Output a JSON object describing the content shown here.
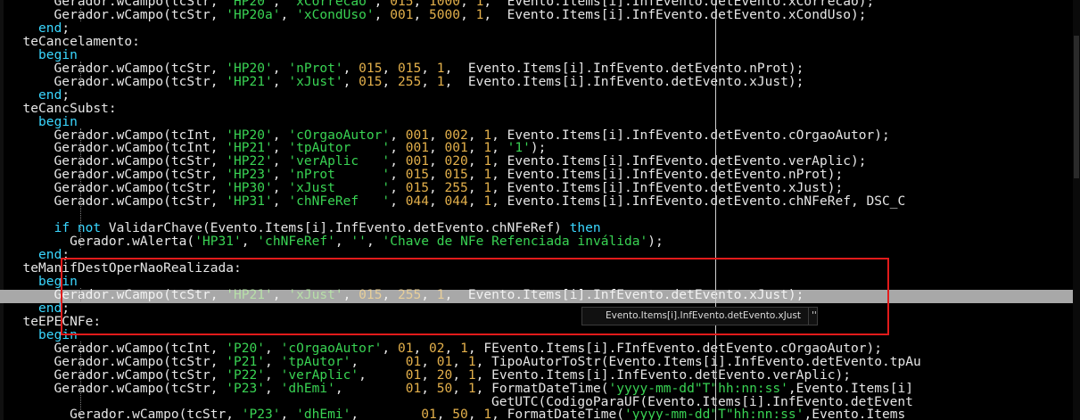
{
  "editor": {
    "lines": [
      [
        {
          "t": "      Gerador.wCampo(tcStr, ",
          "c": "pl"
        },
        {
          "t": "'HP20'",
          "c": "str"
        },
        {
          "t": ", ",
          "c": "pl"
        },
        {
          "t": "'xCorrecao'",
          "c": "str"
        },
        {
          "t": ", ",
          "c": "pl"
        },
        {
          "t": "015",
          "c": "num"
        },
        {
          "t": ", ",
          "c": "pl"
        },
        {
          "t": "1000",
          "c": "num"
        },
        {
          "t": ", ",
          "c": "pl"
        },
        {
          "t": "1",
          "c": "num"
        },
        {
          "t": ",  Evento.Items[i].InfEvento.detEvento.xCorrecao);",
          "c": "pl"
        }
      ],
      [
        {
          "t": "      Gerador.wCampo(tcStr, ",
          "c": "pl"
        },
        {
          "t": "'HP20a'",
          "c": "str"
        },
        {
          "t": ", ",
          "c": "pl"
        },
        {
          "t": "'xCondUso'",
          "c": "str"
        },
        {
          "t": ", ",
          "c": "pl"
        },
        {
          "t": "001",
          "c": "num"
        },
        {
          "t": ", ",
          "c": "pl"
        },
        {
          "t": "5000",
          "c": "num"
        },
        {
          "t": ", ",
          "c": "pl"
        },
        {
          "t": "1",
          "c": "num"
        },
        {
          "t": ",  Evento.Items[i].InfEvento.detEvento.xCondUso);",
          "c": "pl"
        }
      ],
      [
        {
          "t": "    ",
          "c": "pl"
        },
        {
          "t": "end",
          "c": "kw"
        },
        {
          "t": ";",
          "c": "pl"
        }
      ],
      [
        {
          "t": "  teCancelamento:",
          "c": "pl"
        }
      ],
      [
        {
          "t": "    ",
          "c": "pl"
        },
        {
          "t": "begin",
          "c": "kw"
        }
      ],
      [
        {
          "t": "      Gerador.wCampo(tcStr, ",
          "c": "pl"
        },
        {
          "t": "'HP20'",
          "c": "str"
        },
        {
          "t": ", ",
          "c": "pl"
        },
        {
          "t": "'nProt'",
          "c": "str"
        },
        {
          "t": ", ",
          "c": "pl"
        },
        {
          "t": "015",
          "c": "num"
        },
        {
          "t": ", ",
          "c": "pl"
        },
        {
          "t": "015",
          "c": "num"
        },
        {
          "t": ", ",
          "c": "pl"
        },
        {
          "t": "1",
          "c": "num"
        },
        {
          "t": ",  Evento.Items[i].InfEvento.detEvento.nProt);",
          "c": "pl"
        }
      ],
      [
        {
          "t": "      Gerador.wCampo(tcStr, ",
          "c": "pl"
        },
        {
          "t": "'HP21'",
          "c": "str"
        },
        {
          "t": ", ",
          "c": "pl"
        },
        {
          "t": "'xJust'",
          "c": "str"
        },
        {
          "t": ", ",
          "c": "pl"
        },
        {
          "t": "015",
          "c": "num"
        },
        {
          "t": ", ",
          "c": "pl"
        },
        {
          "t": "255",
          "c": "num"
        },
        {
          "t": ", ",
          "c": "pl"
        },
        {
          "t": "1",
          "c": "num"
        },
        {
          "t": ",  Evento.Items[i].InfEvento.detEvento.xJust);",
          "c": "pl"
        }
      ],
      [
        {
          "t": "    ",
          "c": "pl"
        },
        {
          "t": "end",
          "c": "kw"
        },
        {
          "t": ";",
          "c": "pl"
        }
      ],
      [
        {
          "t": "  teCancSubst:",
          "c": "pl"
        }
      ],
      [
        {
          "t": "    ",
          "c": "pl"
        },
        {
          "t": "begin",
          "c": "kw"
        }
      ],
      [
        {
          "t": "      Gerador.wCampo(tcInt, ",
          "c": "pl"
        },
        {
          "t": "'HP20'",
          "c": "str"
        },
        {
          "t": ", ",
          "c": "pl"
        },
        {
          "t": "'cOrgaoAutor'",
          "c": "str"
        },
        {
          "t": ", ",
          "c": "pl"
        },
        {
          "t": "001",
          "c": "num"
        },
        {
          "t": ", ",
          "c": "pl"
        },
        {
          "t": "002",
          "c": "num"
        },
        {
          "t": ", ",
          "c": "pl"
        },
        {
          "t": "1",
          "c": "num"
        },
        {
          "t": ", Evento.Items[i].InfEvento.detEvento.cOrgaoAutor);",
          "c": "pl"
        }
      ],
      [
        {
          "t": "      Gerador.wCampo(tcInt, ",
          "c": "pl"
        },
        {
          "t": "'HP21'",
          "c": "str"
        },
        {
          "t": ", ",
          "c": "pl"
        },
        {
          "t": "'tpAutor    '",
          "c": "str"
        },
        {
          "t": ", ",
          "c": "pl"
        },
        {
          "t": "001",
          "c": "num"
        },
        {
          "t": ", ",
          "c": "pl"
        },
        {
          "t": "001",
          "c": "num"
        },
        {
          "t": ", ",
          "c": "pl"
        },
        {
          "t": "1",
          "c": "num"
        },
        {
          "t": ", ",
          "c": "pl"
        },
        {
          "t": "'1'",
          "c": "str"
        },
        {
          "t": ");",
          "c": "pl"
        }
      ],
      [
        {
          "t": "      Gerador.wCampo(tcStr, ",
          "c": "pl"
        },
        {
          "t": "'HP22'",
          "c": "str"
        },
        {
          "t": ", ",
          "c": "pl"
        },
        {
          "t": "'verAplic   '",
          "c": "str"
        },
        {
          "t": ", ",
          "c": "pl"
        },
        {
          "t": "001",
          "c": "num"
        },
        {
          "t": ", ",
          "c": "pl"
        },
        {
          "t": "020",
          "c": "num"
        },
        {
          "t": ", ",
          "c": "pl"
        },
        {
          "t": "1",
          "c": "num"
        },
        {
          "t": ", Evento.Items[i].InfEvento.detEvento.verAplic);",
          "c": "pl"
        }
      ],
      [
        {
          "t": "      Gerador.wCampo(tcStr, ",
          "c": "pl"
        },
        {
          "t": "'HP23'",
          "c": "str"
        },
        {
          "t": ", ",
          "c": "pl"
        },
        {
          "t": "'nProt      '",
          "c": "str"
        },
        {
          "t": ", ",
          "c": "pl"
        },
        {
          "t": "015",
          "c": "num"
        },
        {
          "t": ", ",
          "c": "pl"
        },
        {
          "t": "015",
          "c": "num"
        },
        {
          "t": ", ",
          "c": "pl"
        },
        {
          "t": "1",
          "c": "num"
        },
        {
          "t": ", Evento.Items[i].InfEvento.detEvento.nProt);",
          "c": "pl"
        }
      ],
      [
        {
          "t": "      Gerador.wCampo(tcStr, ",
          "c": "pl"
        },
        {
          "t": "'HP30'",
          "c": "str"
        },
        {
          "t": ", ",
          "c": "pl"
        },
        {
          "t": "'xJust      '",
          "c": "str"
        },
        {
          "t": ", ",
          "c": "pl"
        },
        {
          "t": "015",
          "c": "num"
        },
        {
          "t": ", ",
          "c": "pl"
        },
        {
          "t": "255",
          "c": "num"
        },
        {
          "t": ", ",
          "c": "pl"
        },
        {
          "t": "1",
          "c": "num"
        },
        {
          "t": ", Evento.Items[i].InfEvento.detEvento.xJust);",
          "c": "pl"
        }
      ],
      [
        {
          "t": "      Gerador.wCampo(tcStr, ",
          "c": "pl"
        },
        {
          "t": "'HP31'",
          "c": "str"
        },
        {
          "t": ", ",
          "c": "pl"
        },
        {
          "t": "'chNFeRef   '",
          "c": "str"
        },
        {
          "t": ", ",
          "c": "pl"
        },
        {
          "t": "044",
          "c": "num"
        },
        {
          "t": ", ",
          "c": "pl"
        },
        {
          "t": "044",
          "c": "num"
        },
        {
          "t": ", ",
          "c": "pl"
        },
        {
          "t": "1",
          "c": "num"
        },
        {
          "t": ", Evento.Items[i].InfEvento.detEvento.chNFeRef, DSC_C",
          "c": "pl"
        }
      ],
      [],
      [
        {
          "t": "      ",
          "c": "pl"
        },
        {
          "t": "if",
          "c": "kw"
        },
        {
          "t": " ",
          "c": "pl"
        },
        {
          "t": "not",
          "c": "kw"
        },
        {
          "t": " ValidarChave(Evento.Items[i].InfEvento.detEvento.chNFeRef) ",
          "c": "pl"
        },
        {
          "t": "then",
          "c": "kw"
        }
      ],
      [
        {
          "t": "        Gerador.wAlerta(",
          "c": "pl"
        },
        {
          "t": "'HP31'",
          "c": "str"
        },
        {
          "t": ", ",
          "c": "pl"
        },
        {
          "t": "'chNFeRef'",
          "c": "str"
        },
        {
          "t": ", ",
          "c": "pl"
        },
        {
          "t": "''",
          "c": "str"
        },
        {
          "t": ", ",
          "c": "pl"
        },
        {
          "t": "'Chave de NFe Refenciada inválida'",
          "c": "str"
        },
        {
          "t": ");",
          "c": "pl"
        }
      ],
      [
        {
          "t": "    ",
          "c": "pl"
        },
        {
          "t": "end",
          "c": "kw"
        },
        {
          "t": ";",
          "c": "pl"
        }
      ],
      [
        {
          "t": "  teManifDestOperNaoRealizada:",
          "c": "pl"
        }
      ],
      [
        {
          "t": "    ",
          "c": "pl"
        },
        {
          "t": "begin",
          "c": "kw"
        }
      ],
      [
        {
          "t": "      Gerador.wCampo(tcStr, ",
          "c": "pl"
        },
        {
          "t": "'HP21'",
          "c": "str"
        },
        {
          "t": ", ",
          "c": "pl"
        },
        {
          "t": "'xJust'",
          "c": "str"
        },
        {
          "t": ", ",
          "c": "pl"
        },
        {
          "t": "015",
          "c": "num"
        },
        {
          "t": ", ",
          "c": "pl"
        },
        {
          "t": "255",
          "c": "num"
        },
        {
          "t": ", ",
          "c": "pl"
        },
        {
          "t": "1",
          "c": "num"
        },
        {
          "t": ",  Evento.Items[i].InfEvento.detEvento.xJust);",
          "c": "pl"
        }
      ],
      [
        {
          "t": "    ",
          "c": "pl"
        },
        {
          "t": "end",
          "c": "kw"
        },
        {
          "t": ";",
          "c": "pl"
        }
      ],
      [
        {
          "t": "  teEPECNFe:",
          "c": "pl"
        }
      ],
      [
        {
          "t": "    ",
          "c": "pl"
        },
        {
          "t": "begin",
          "c": "kw"
        }
      ],
      [
        {
          "t": "      Gerador.wCampo(tcInt, ",
          "c": "pl"
        },
        {
          "t": "'P20'",
          "c": "str"
        },
        {
          "t": ", ",
          "c": "pl"
        },
        {
          "t": "'cOrgaoAutor'",
          "c": "str"
        },
        {
          "t": ", ",
          "c": "pl"
        },
        {
          "t": "01",
          "c": "num"
        },
        {
          "t": ", ",
          "c": "pl"
        },
        {
          "t": "02",
          "c": "num"
        },
        {
          "t": ", ",
          "c": "pl"
        },
        {
          "t": "1",
          "c": "num"
        },
        {
          "t": ", FEvento.Items[i].FInfEvento.detEvento.cOrgaoAutor);",
          "c": "pl"
        }
      ],
      [
        {
          "t": "      Gerador.wCampo(tcStr, ",
          "c": "pl"
        },
        {
          "t": "'P21'",
          "c": "str"
        },
        {
          "t": ", ",
          "c": "pl"
        },
        {
          "t": "'tpAutor'",
          "c": "str"
        },
        {
          "t": ",      ",
          "c": "pl"
        },
        {
          "t": "01",
          "c": "num"
        },
        {
          "t": ", ",
          "c": "pl"
        },
        {
          "t": "01",
          "c": "num"
        },
        {
          "t": ", ",
          "c": "pl"
        },
        {
          "t": "1",
          "c": "num"
        },
        {
          "t": ", TipoAutorToStr(Evento.Items[i].InfEvento.detEvento.tpAu",
          "c": "pl"
        }
      ],
      [
        {
          "t": "      Gerador.wCampo(tcStr, ",
          "c": "pl"
        },
        {
          "t": "'P22'",
          "c": "str"
        },
        {
          "t": ", ",
          "c": "pl"
        },
        {
          "t": "'verAplic'",
          "c": "str"
        },
        {
          "t": ",     ",
          "c": "pl"
        },
        {
          "t": "01",
          "c": "num"
        },
        {
          "t": ", ",
          "c": "pl"
        },
        {
          "t": "20",
          "c": "num"
        },
        {
          "t": ", ",
          "c": "pl"
        },
        {
          "t": "1",
          "c": "num"
        },
        {
          "t": ", Evento.Items[i].InfEvento.detEvento.verAplic);",
          "c": "pl"
        }
      ],
      [
        {
          "t": "      Gerador.wCampo(tcStr, ",
          "c": "pl"
        },
        {
          "t": "'P23'",
          "c": "str"
        },
        {
          "t": ", ",
          "c": "pl"
        },
        {
          "t": "'dhEmi'",
          "c": "str"
        },
        {
          "t": ",        ",
          "c": "pl"
        },
        {
          "t": "01",
          "c": "num"
        },
        {
          "t": ", ",
          "c": "pl"
        },
        {
          "t": "50",
          "c": "num"
        },
        {
          "t": ", ",
          "c": "pl"
        },
        {
          "t": "1",
          "c": "num"
        },
        {
          "t": ", FormatDateTime(",
          "c": "pl"
        },
        {
          "t": "'yyyy-mm-dd\"T\"hh:nn:ss'",
          "c": "str"
        },
        {
          "t": ",Evento.Items[i]",
          "c": "pl"
        }
      ],
      [
        {
          "t": "                                                              GetUTC(CodigoParaUF(Evento.Items[i].InfEvento.detEvent",
          "c": "pl"
        }
      ],
      [
        {
          "t": "        Gerador.wCampo(tcStr, ",
          "c": "pl"
        },
        {
          "t": "'P23'",
          "c": "str"
        },
        {
          "t": ", ",
          "c": "pl"
        },
        {
          "t": "'dhEmi'",
          "c": "str"
        },
        {
          "t": ",        ",
          "c": "pl"
        },
        {
          "t": "01",
          "c": "num"
        },
        {
          "t": ", ",
          "c": "pl"
        },
        {
          "t": "50",
          "c": "num"
        },
        {
          "t": ", ",
          "c": "pl"
        },
        {
          "t": "1",
          "c": "num"
        },
        {
          "t": ", FormatDateTime(",
          "c": "pl"
        },
        {
          "t": "'yyyy-mm-dd\"T\"hh:nn:ss'",
          "c": "str"
        },
        {
          "t": ",Evento.Items",
          "c": "pl"
        }
      ]
    ],
    "highlight_line": 22
  },
  "tooltip": {
    "expression": "Evento.Items[i].InfEvento.detEvento.xJust",
    "value": "''"
  },
  "colors": {
    "background": "#000000",
    "keyword": "#3ad7ff",
    "string": "#39d353",
    "number": "#e3b04b",
    "text": "#e6e6e6",
    "line_highlight": "#a8a8a8",
    "selection_box": "#e11b1b"
  }
}
